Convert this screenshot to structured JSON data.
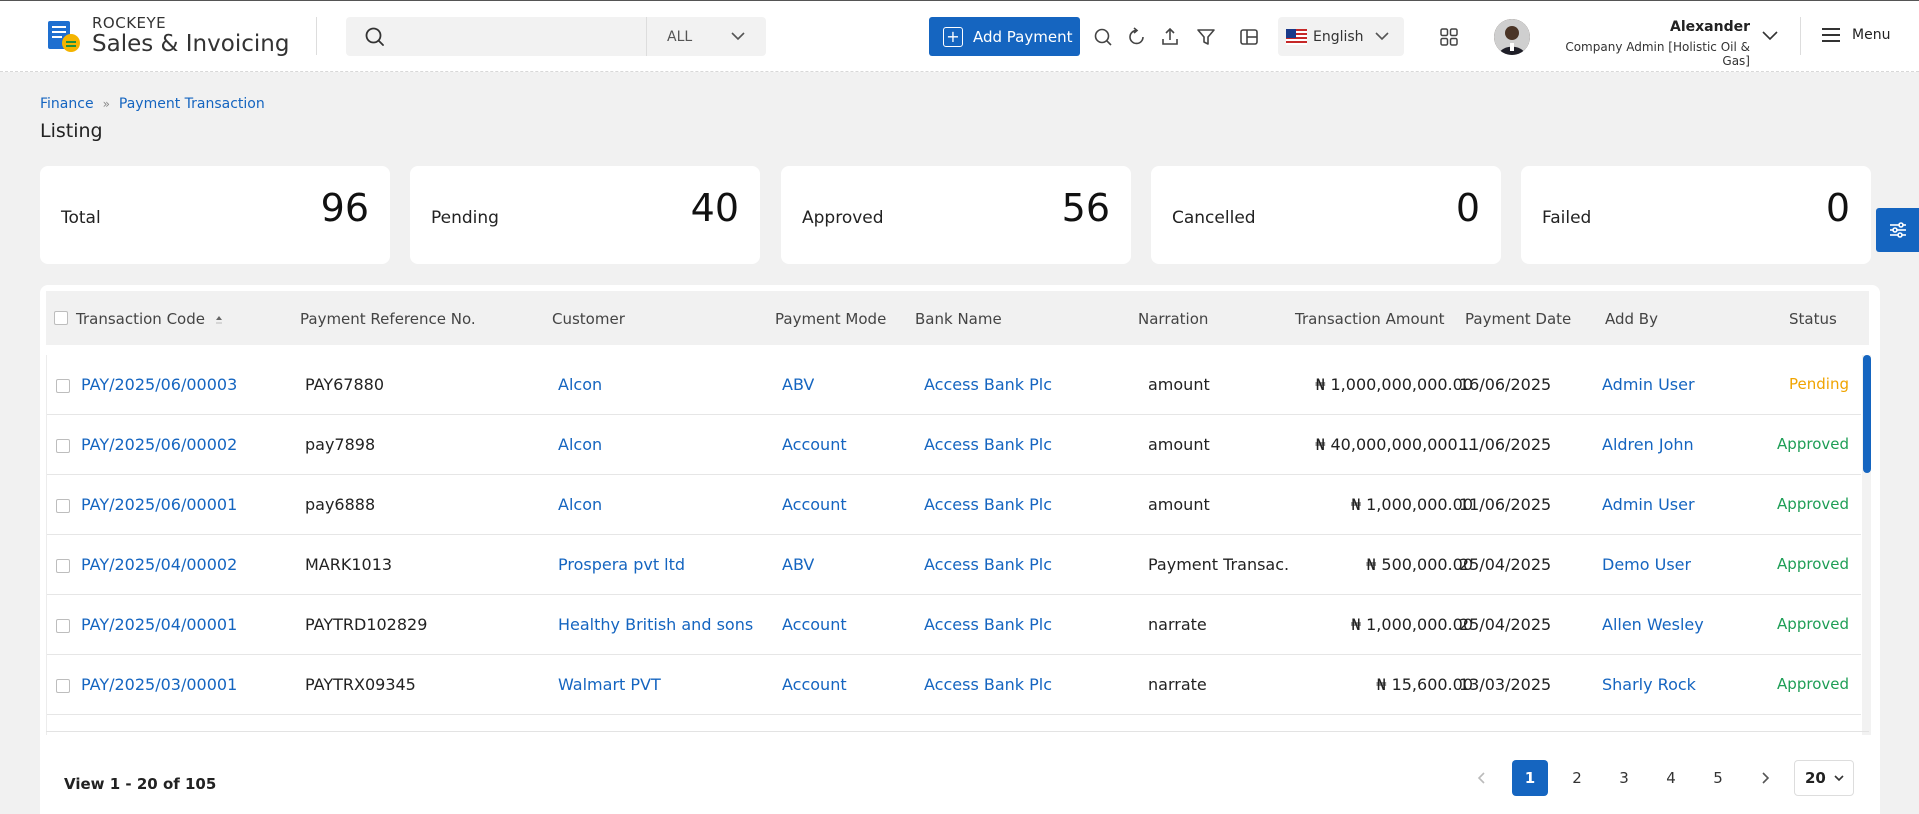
{
  "header": {
    "brand_top": "ROCKEYE",
    "brand_main": "Sales & Invoicing",
    "search_placeholder": "",
    "scope": "ALL",
    "add_button": "Add Payment",
    "language": "English",
    "user_name": "Alexander",
    "user_role": "Company Admin [Holistic Oil & Gas]",
    "menu_label": "Menu"
  },
  "breadcrumb": [
    "Finance",
    "Payment Transaction"
  ],
  "page_title": "Listing",
  "stats": [
    {
      "label": "Total",
      "value": "96"
    },
    {
      "label": "Pending",
      "value": "40"
    },
    {
      "label": "Approved",
      "value": "56"
    },
    {
      "label": "Cancelled",
      "value": "0"
    },
    {
      "label": "Failed",
      "value": "0"
    }
  ],
  "table": {
    "columns": [
      "Transaction Code",
      "Payment Reference No.",
      "Customer",
      "Payment Mode",
      "Bank Name",
      "Narration",
      "Transaction Amount",
      "Payment Date",
      "Add By",
      "Status"
    ],
    "rows": [
      {
        "code": "PAY/2025/06/00003",
        "ref": "PAY67880",
        "customer": "Alcon",
        "mode": "ABV",
        "bank": "Access Bank Plc",
        "narration": "amount",
        "amount": "₦ 1,000,000,000.00",
        "date": "16/06/2025",
        "by": "Admin User",
        "status": "Pending"
      },
      {
        "code": "PAY/2025/06/00002",
        "ref": "pay7898",
        "customer": "Alcon",
        "mode": "Account",
        "bank": "Access Bank Plc",
        "narration": "amount",
        "amount": "₦ 40,000,000,000...",
        "date": "11/06/2025",
        "by": "Aldren John",
        "status": "Approved"
      },
      {
        "code": "PAY/2025/06/00001",
        "ref": "pay6888",
        "customer": "Alcon",
        "mode": "Account",
        "bank": "Access Bank Plc",
        "narration": "amount",
        "amount": "₦ 1,000,000.00",
        "date": "11/06/2025",
        "by": "Admin User",
        "status": "Approved"
      },
      {
        "code": "PAY/2025/04/00002",
        "ref": "MARK1013",
        "customer": "Prospera pvt ltd",
        "mode": "ABV",
        "bank": "Access Bank Plc",
        "narration": "Payment Transac...",
        "amount": "₦ 500,000.00",
        "date": "25/04/2025",
        "by": "Demo User",
        "status": "Approved"
      },
      {
        "code": "PAY/2025/04/00001",
        "ref": "PAYTRD102829",
        "customer": "Healthy British and sons",
        "mode": "Account",
        "bank": "Access Bank Plc",
        "narration": "narrate",
        "amount": "₦ 1,000,000.00",
        "date": "25/04/2025",
        "by": "Allen Wesley",
        "status": "Approved"
      },
      {
        "code": "PAY/2025/03/00001",
        "ref": "PAYTRX09345",
        "customer": "Walmart PVT",
        "mode": "Account",
        "bank": "Access Bank Plc",
        "narration": "narrate",
        "amount": "₦ 15,600.00",
        "date": "13/03/2025",
        "by": "Sharly Rock",
        "status": "Approved"
      }
    ]
  },
  "footer": {
    "view_text": "View 1 - 20 of 105",
    "pages": [
      "1",
      "2",
      "3",
      "4",
      "5"
    ],
    "active_page": "1",
    "page_size": "20"
  },
  "colors": {
    "accent": "#1565c0",
    "pending": "#f0a400",
    "approved": "#1e9e56"
  },
  "icons": [
    "search-icon",
    "chevron-down-icon",
    "plus-icon",
    "zoom-icon",
    "refresh-icon",
    "upload-icon",
    "filter-icon",
    "columns-icon",
    "us-flag-icon",
    "apps-grid-icon",
    "hamburger-icon",
    "sliders-icon",
    "sort-asc-icon",
    "chevron-left-icon",
    "chevron-right-icon"
  ]
}
